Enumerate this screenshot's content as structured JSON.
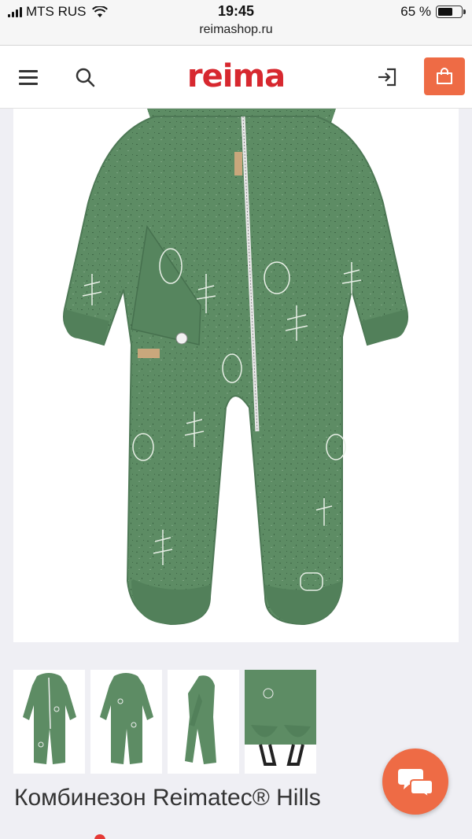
{
  "status_bar": {
    "carrier": "MTS RUS",
    "time": "19:45",
    "battery": "65 %",
    "battery_level": 0.65
  },
  "browser": {
    "url": "reimashop.ru"
  },
  "header": {
    "logo": "reima"
  },
  "icons": {
    "menu": "menu-icon",
    "search": "search-icon",
    "login": "login-icon",
    "cart": "shopping-bag-icon",
    "chat": "chat-icon"
  },
  "colors": {
    "brand_red": "#d7282f",
    "accent_orange": "#ee6b45",
    "garment_green": "#5b8a62"
  },
  "product": {
    "title": "Комбинезон Reimatec® Hills",
    "thumbnails": [
      "front",
      "back",
      "side",
      "detail"
    ],
    "selected_thumbnail": 0
  }
}
